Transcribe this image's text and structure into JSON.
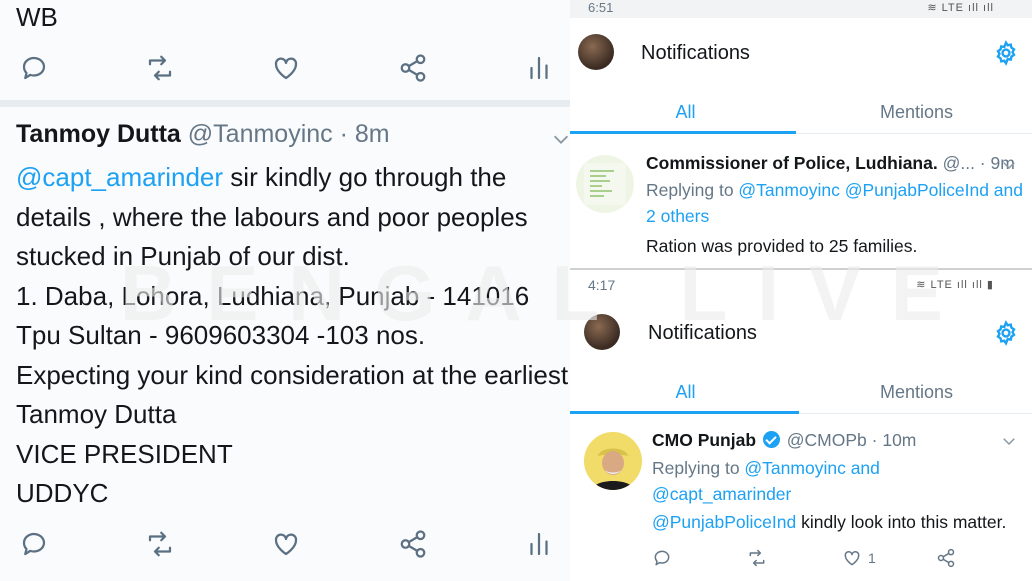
{
  "left": {
    "top_text": "WB",
    "tweet": {
      "author_name": "Tanmoy Dutta",
      "author_meta": "@Tanmoyinc · 8m",
      "body_mention": "@capt_amarinder",
      "body_line1_rest": " sir kindly go through the",
      "body_lines": [
        "details , where the labours and poor peoples",
        "stucked in Punjab of our dist.",
        "1. Daba, Lohora, Ludhiana, Punjab - 141016",
        "Tpu Sultan - 9609603304 -103 nos.",
        "Expecting your kind consideration at the earliest.",
        "Tanmoy Dutta",
        "VICE PRESIDENT",
        "UDDYC"
      ]
    },
    "action_icons": [
      "reply-icon",
      "retweet-icon",
      "like-icon",
      "share-icon",
      "analytics-icon"
    ]
  },
  "panel1": {
    "status_time": "6:51",
    "status_icons": "≋ LTE ıll ıll",
    "title": "Notifications",
    "tabs": {
      "all": "All",
      "mentions": "Mentions"
    },
    "item": {
      "name": "Commissioner of Police, Ludhiana.",
      "meta": " @... · 9m",
      "replying_prefix": "Replying to ",
      "replying_mentions": "@Tanmoyinc @PunjabPoliceInd and",
      "replying_more": "2 others",
      "text": "Ration was provided to 25 families."
    }
  },
  "panel2": {
    "status_time": "4:17",
    "status_icons": "≋ LTE ıll ıll ▮",
    "title": "Notifications",
    "tabs": {
      "all": "All",
      "mentions": "Mentions"
    },
    "item": {
      "name": "CMO Punjab",
      "meta": "@CMOPb · 10m",
      "replying_prefix": "Replying to ",
      "replying_line1": "@Tanmoyinc and",
      "replying_line2": "@capt_amarinder",
      "text_mention": "@PunjabPoliceInd",
      "text_rest": " kindly look into this matter.",
      "like_count": "1"
    }
  },
  "watermark": "BENGAL LIVE",
  "colors": {
    "accent": "#1da1f2",
    "icon_grey": "#5b7083",
    "text": "#14171a",
    "meta": "#657786"
  }
}
